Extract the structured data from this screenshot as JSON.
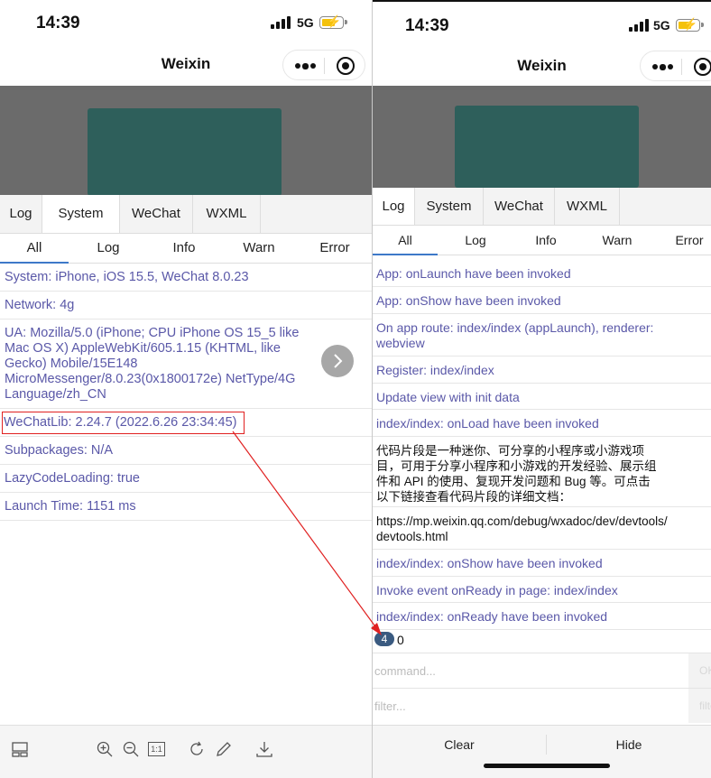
{
  "status": {
    "time": "14:39",
    "network": "5G"
  },
  "nav": {
    "title": "Weixin"
  },
  "left": {
    "tabs": [
      "Log",
      "System",
      "WeChat",
      "WXML"
    ],
    "active_tab": "System",
    "subtabs": [
      "All",
      "Log",
      "Info",
      "Warn",
      "Error"
    ],
    "active_subtab": "All",
    "rows": [
      "System: iPhone, iOS 15.5, WeChat 8.0.23",
      "Network: 4g",
      "UA: Mozilla/5.0 (iPhone; CPU iPhone OS 15_5 like Mac OS X) AppleWebKit/605.1.15 (KHTML, like Gecko) Mobile/15E148 MicroMessenger/8.0.23(0x1800172e) NetType/4G Language/zh_CN",
      "WeChatLib: 2.24.7 (2022.6.26 23:34:45)",
      "Subpackages: N/A",
      "LazyCodeLoading: true",
      "Launch Time: 1151 ms"
    ],
    "toolbar_icons": [
      "layout-icon",
      "zoom-in-icon",
      "zoom-out-icon",
      "actual-size-icon",
      "rotate-icon",
      "pen-icon",
      "download-icon"
    ],
    "actual_size_label": "1:1"
  },
  "right": {
    "tabs": [
      "Log",
      "System",
      "WeChat",
      "WXML"
    ],
    "active_tab": "Log",
    "subtabs": [
      "All",
      "Log",
      "Info",
      "Warn",
      "Error"
    ],
    "active_subtab": "All",
    "rows": [
      "App: onLaunch have been invoked",
      "App: onShow have been invoked",
      "On app route: index/index (appLaunch), renderer: webview",
      "Register: index/index",
      "Update view with init data",
      "index/index: onLoad have been invoked",
      "代码片段是一种迷你、可分享的小程序或小游戏项目，可用于分享小程序和小游戏的开发经验、展示组件和 API 的使用、复现开发问题和 Bug 等。可点击以下链接查看代码片段的详细文档：",
      "https://mp.weixin.qq.com/debug/wxadoc/dev/devtools/devtools.html",
      "index/index: onShow have been invoked",
      "Invoke event onReady in page: index/index",
      "index/index: onReady have been invoked"
    ],
    "black_rows": [
      6,
      7
    ],
    "badge_count": "4",
    "error_count": "0",
    "command_placeholder": "command...",
    "filter_placeholder": "filter...",
    "command_button": "OK",
    "filter_button": "filter",
    "clear_label": "Clear",
    "hide_label": "Hide"
  },
  "colors": {
    "log_text": "#5a58a8",
    "preview_bg": "#6b6b6b",
    "preview_box": "#2e5f5b",
    "highlight": "#e02020",
    "tab_underline": "#3d79c8"
  }
}
